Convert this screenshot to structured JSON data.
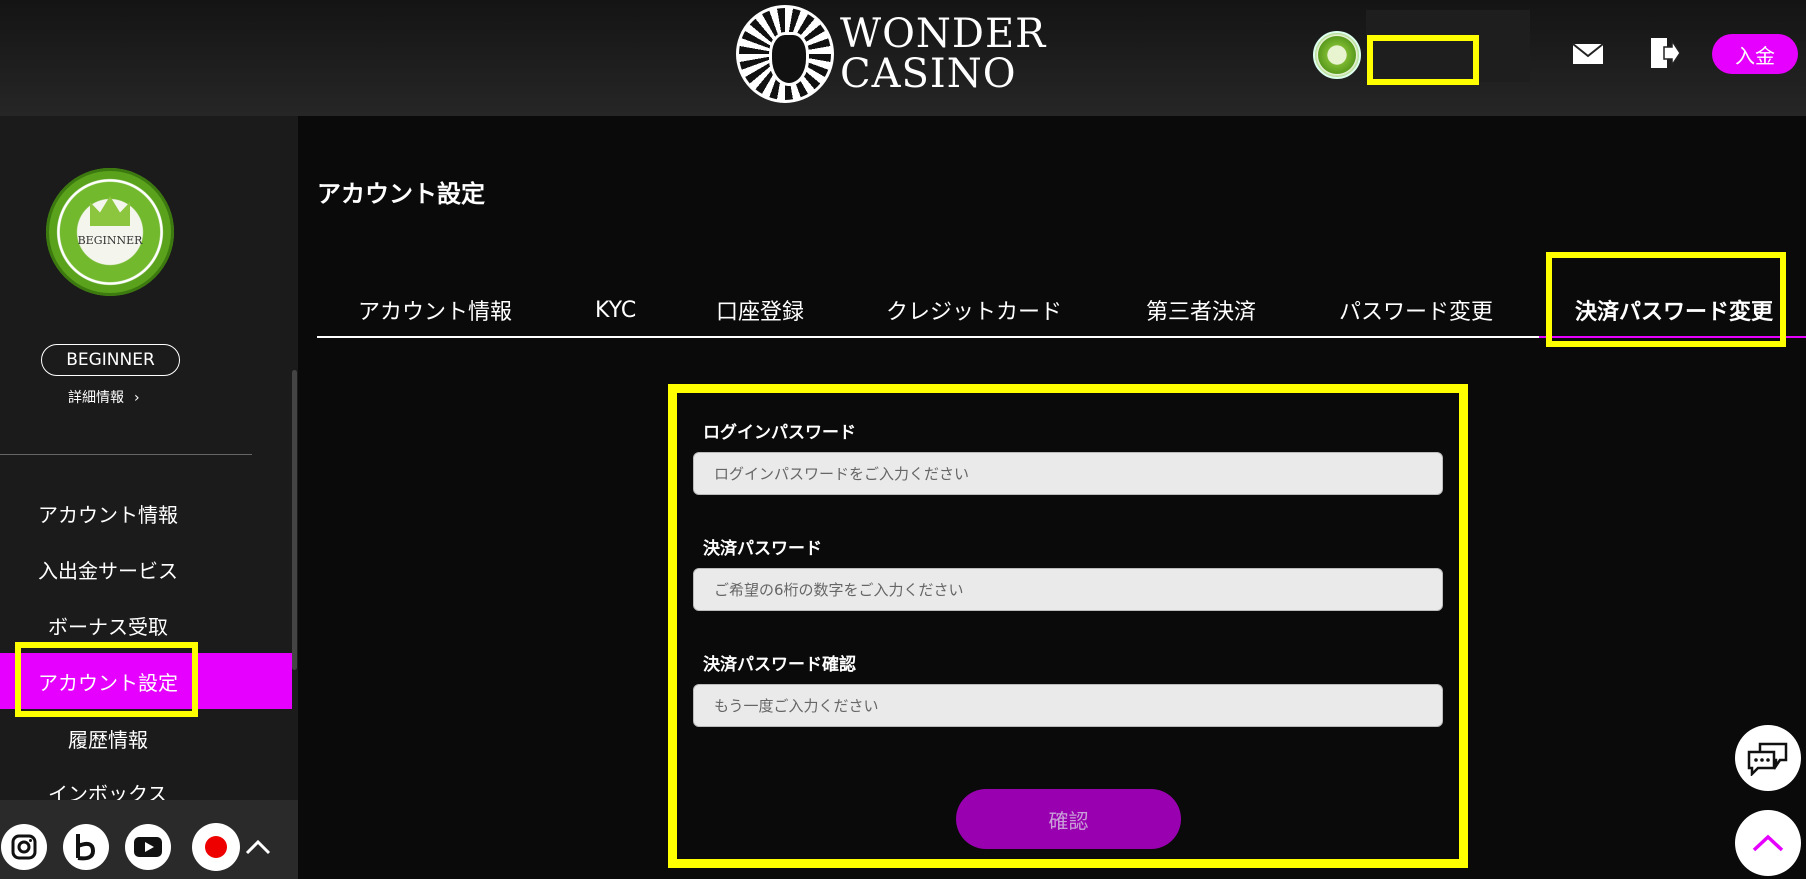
{
  "header": {
    "brand_line1": "WONDER",
    "brand_line2": "CASINO",
    "deposit_label": "入金"
  },
  "sidebar": {
    "rank_chip_text": "BEGINNER",
    "rank_label": "BEGINNER",
    "detail_link": "詳細情報",
    "menu": [
      {
        "label": "アカウント情報"
      },
      {
        "label": "入出金サービス"
      },
      {
        "label": "ボーナス受取"
      },
      {
        "label": "アカウント設定"
      },
      {
        "label": "履歴情報"
      },
      {
        "label": "インボックス"
      }
    ]
  },
  "main": {
    "title": "アカウント設定",
    "tabs": [
      {
        "label": "アカウント情報"
      },
      {
        "label": "KYC"
      },
      {
        "label": "口座登録"
      },
      {
        "label": "クレジットカード"
      },
      {
        "label": "第三者決済"
      },
      {
        "label": "パスワード変更"
      },
      {
        "label": "決済パスワード変更"
      }
    ],
    "form": {
      "login_password_label": "ログインパスワード",
      "login_password_placeholder": "ログインパスワードをご入力ください",
      "payment_password_label": "決済パスワード",
      "payment_password_placeholder": "ご希望の6桁の数字をご入力ください",
      "payment_password_confirm_label": "決済パスワード確認",
      "payment_password_confirm_placeholder": "もう一度ご入力ください",
      "submit_label": "確認"
    }
  },
  "colors": {
    "accent": "#e600ff",
    "highlight": "#ffff00",
    "button": "#9900b0"
  },
  "icons": [
    "mail-icon",
    "logout-icon",
    "instagram-icon",
    "b-icon",
    "youtube-icon",
    "japan-flag-icon",
    "chevron-up-icon",
    "chat-icon",
    "scroll-top-icon"
  ]
}
